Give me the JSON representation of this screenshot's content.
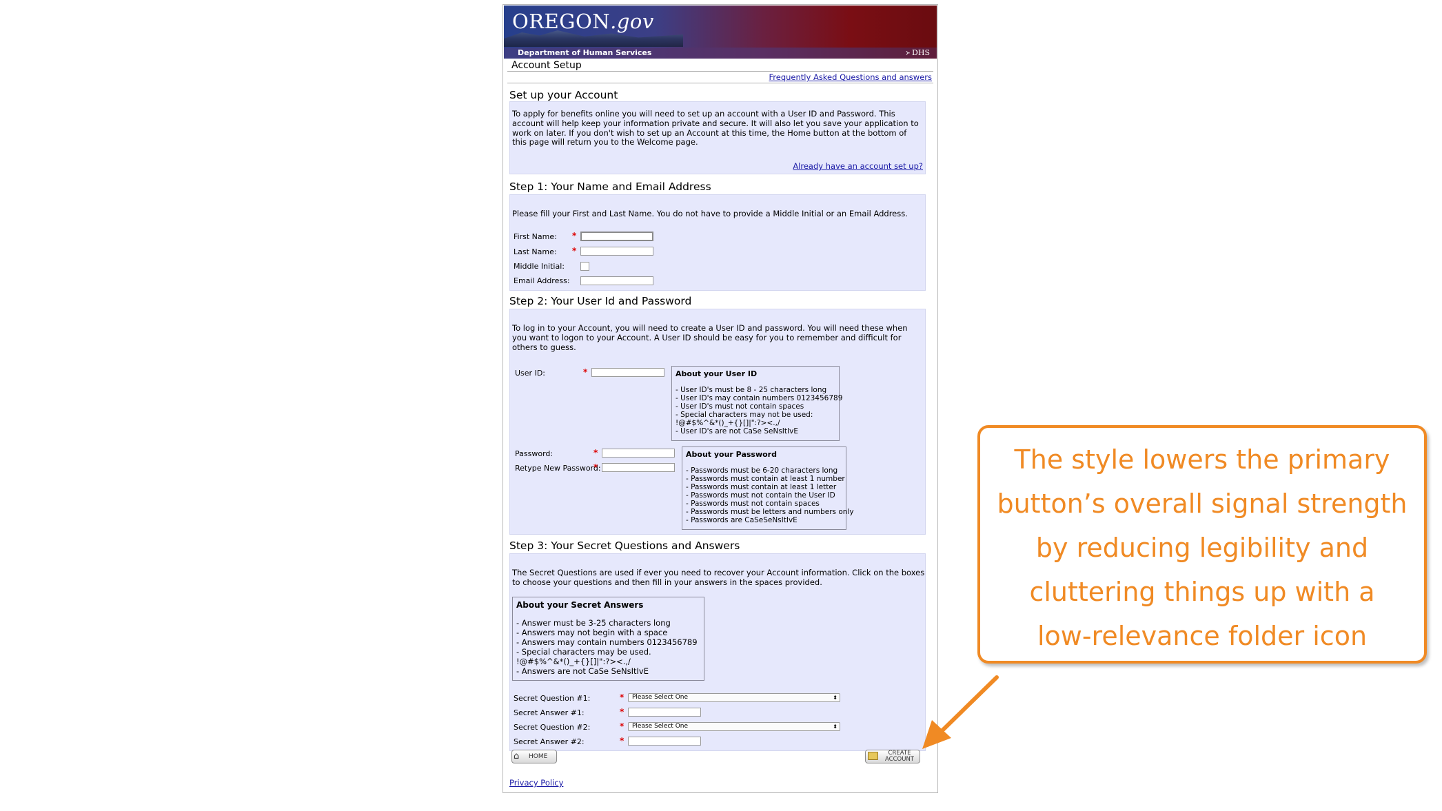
{
  "banner": {
    "logo_main": "OREGON",
    "logo_suffix": ".gov",
    "dept": "Department of Human Services",
    "dhs": "DHS"
  },
  "page_title": "Account Setup",
  "faq_link": "Frequently Asked Questions and answers",
  "intro": {
    "heading": "Set up your Account",
    "lines": [
      "To apply for benefits online you will need to set up an account with a User ID and Password. This",
      "account will help keep your information private and secure. It will also let you save your application to",
      "work on later. If you don't wish to set up an Account at this time, the Home button at the bottom of",
      "this page will return you to the Welcome page."
    ],
    "link": "Already have an account set up?"
  },
  "step1": {
    "heading": "Step 1: Your Name and Email Address",
    "text": "Please fill your First and Last Name. You do not have to provide a Middle Initial or an Email Address.",
    "labels": {
      "first": "First Name:",
      "last": "Last Name:",
      "middle": "Middle Initial:",
      "email": "Email Address:"
    }
  },
  "step2": {
    "heading": "Step 2: Your User Id and Password",
    "lines": [
      "To log in to your Account, you will need to create a User ID and password. You will need these when",
      "you want to logon to your Account. A User ID should be easy for you to remember and difficult for",
      "others to guess."
    ],
    "labels": {
      "userid": "User ID:",
      "password": "Password:",
      "retype": "Retype New Password:"
    },
    "userid_info": {
      "title": "About your User ID",
      "lines": [
        "- User ID's must be 8 - 25 characters long",
        "- User ID's may contain numbers 0123456789",
        "- User ID's must not contain spaces",
        "- Special characters may not be used:",
        "!@#$%^&*()_+{}[]|\":?><.,/",
        "- User ID's are not CaSe SeNsItIvE"
      ]
    },
    "password_info": {
      "title": "About your Password",
      "lines": [
        "- Passwords must be 6-20 characters long",
        "- Passwords must contain at least 1 number",
        "- Passwords must contain at least 1 letter",
        "- Passwords must not contain the User ID",
        "- Passwords must not contain spaces",
        "- Passwords must be letters and numbers only",
        "- Passwords are CaSeSeNsItIvE"
      ]
    }
  },
  "step3": {
    "heading": "Step 3: Your Secret Questions and Answers",
    "lines": [
      "The Secret Questions are used if ever you need to recover your Account information. Click on the boxes",
      "to choose your questions and then fill in your answers in the spaces provided."
    ],
    "answers_info": {
      "title": "About your Secret Answers",
      "lines": [
        "- Answer must be 3-25 characters long",
        "- Answers may not begin with a space",
        "- Answers may contain numbers 0123456789",
        "- Special characters may be used.",
        "!@#$%^&*()_+{}[]|\":?><.,/",
        "- Answers are not CaSe SeNsItIvE"
      ]
    },
    "labels": {
      "q1": "Secret Question #1:",
      "a1": "Secret Answer #1:",
      "q2": "Secret Question #2:",
      "a2": "Secret Answer #2:"
    },
    "select_placeholder": "Please Select One"
  },
  "buttons": {
    "home": "HOME",
    "create_line1": "CREATE",
    "create_line2": "ACCOUNT"
  },
  "privacy": "Privacy Policy",
  "callout": {
    "lines": [
      "The style lowers the primary",
      "button’s overall signal strength",
      "by reducing legibility and",
      "cluttering things up with a",
      "low-relevance folder icon"
    ]
  },
  "colors": {
    "accent": "#f08a24",
    "panel": "#e6e8fc",
    "link": "#1a1aa6",
    "required": "#dd0000"
  }
}
